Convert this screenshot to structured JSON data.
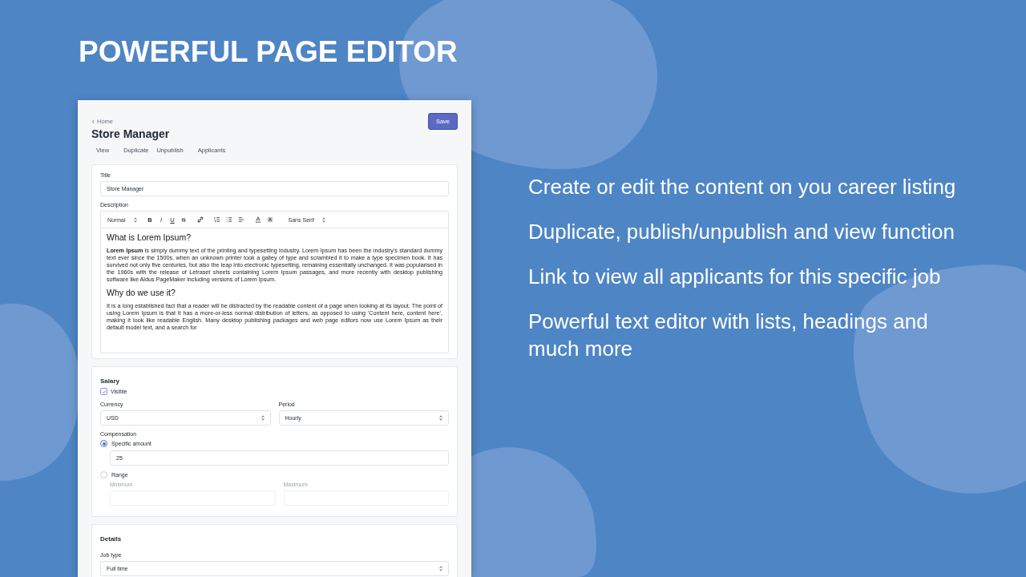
{
  "headline": "POWERFUL PAGE EDITOR",
  "app": {
    "breadcrumb": "Home",
    "title": "Store Manager",
    "save_button": "Save",
    "actions": [
      "View",
      "Duplicate",
      "Unpublish",
      "Applicants"
    ],
    "title_field": {
      "label": "Title",
      "value": "Store Manager"
    },
    "description": {
      "label": "Description",
      "toolbar": {
        "format": "Normal",
        "marks": [
          "B",
          "I",
          "U",
          "S"
        ],
        "font": "Sans Serif"
      },
      "content": [
        {
          "kind": "heading",
          "text": "What is Lorem Ipsum?"
        },
        {
          "kind": "paragraph",
          "text": "**Lorem Ipsum** is simply dummy text of the printing and typesetting industry. Lorem Ipsum has been the industry's standard dummy text ever since the 1500s, when an unknown printer took a galley of type and scrambled it to make a type specimen book. It has survived not only five centuries, but also the leap into electronic typesetting, remaining essentially unchanged. It was popularised in the 1960s with the release of Letraset sheets containing Lorem Ipsum passages, and more recently with desktop publishing software like Aldus PageMaker including versions of Lorem Ipsum."
        },
        {
          "kind": "heading",
          "text": "Why do we use it?"
        },
        {
          "kind": "paragraph",
          "text": "It is a long established fact that a reader will be distracted by the readable content of a page when looking at its layout. The point of using Lorem Ipsum is that it has a more-or-less normal distribution of letters, as opposed to using 'Content here, content here', making it look like readable English. Many desktop publishing packages and web page editors now use Lorem Ipsum as their default model text, and a search for"
        }
      ]
    },
    "salary": {
      "heading": "Salary",
      "visible": {
        "label": "Visible",
        "checked": true
      },
      "currency": {
        "label": "Currency",
        "value": "USD"
      },
      "period": {
        "label": "Period",
        "value": "Hourly"
      },
      "compensation": {
        "label": "Compensation",
        "options": [
          {
            "label": "Specific amount",
            "selected": true
          },
          {
            "label": "Range",
            "selected": false
          }
        ]
      },
      "amount": "25",
      "range_fields": [
        {
          "label": "Minimum",
          "disabled": true
        },
        {
          "label": "Maximum",
          "disabled": true
        }
      ]
    },
    "details": {
      "heading": "Details",
      "job_type": {
        "label": "Job type",
        "value": "Full time"
      }
    }
  },
  "features": [
    "Create or edit the content on you career listing",
    "Duplicate, publish/unpublish and view function",
    "Link to view all applicants for this specific job",
    "Powerful text editor with lists, headings and much more"
  ]
}
